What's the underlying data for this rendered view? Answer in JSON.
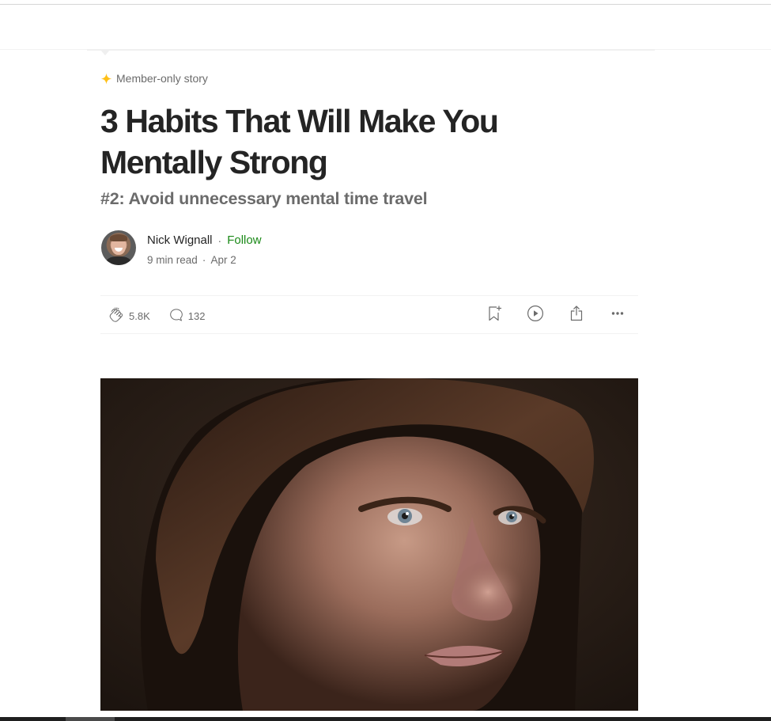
{
  "page": {
    "member_badge": {
      "icon": "star-sparkle-icon",
      "label": "Member-only story",
      "color": "#ffc017"
    },
    "title": "3 Habits That Will Make You Mentally Strong",
    "subtitle": "#2: Avoid unnecessary mental time travel",
    "author": {
      "name": "Nick Wignall",
      "separator": "·",
      "follow_label": "Follow",
      "follow_color": "#1a8917",
      "read_time": "9 min read",
      "date": "Apr 2"
    },
    "actions": {
      "claps": {
        "icon": "clap-icon",
        "count": "5.8K"
      },
      "comments": {
        "icon": "comment-bubble-icon",
        "count": "132"
      },
      "bookmark": {
        "icon": "bookmark-add-icon"
      },
      "listen": {
        "icon": "play-circle-icon"
      },
      "share": {
        "icon": "share-icon"
      },
      "more": {
        "icon": "more-horizontal-icon"
      }
    },
    "hero_image": {
      "description": "Close-up portrait of a man with brown hair and blue eyes looking up and to the right, dark background"
    }
  }
}
